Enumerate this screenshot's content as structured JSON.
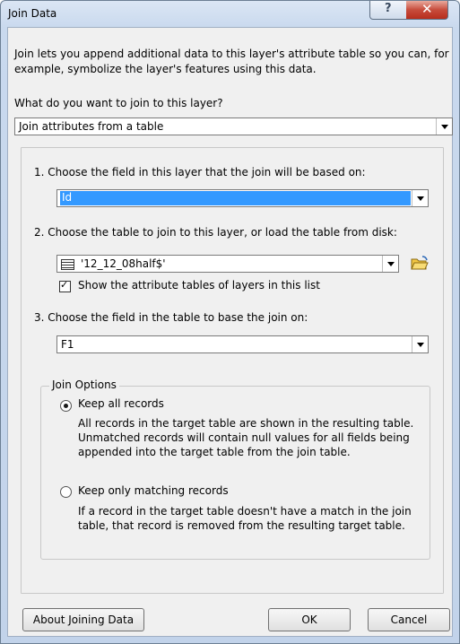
{
  "window": {
    "title": "Join Data",
    "help_glyph": "?",
    "close_glyph": "✕"
  },
  "intro": "Join lets you append additional data to this layer's attribute table so you can, for example, symbolize the layer's features using this data.",
  "question": "What do you want to join to this layer?",
  "join_type": {
    "value": "Join attributes from a table"
  },
  "step1": {
    "label": "1.  Choose the field in this layer that the join will be based on:",
    "value": "Id"
  },
  "step2": {
    "label": "2.  Choose the table to join to this layer, or load the table from disk:",
    "value": "'12_12_08half$'",
    "table_icon": "table-icon",
    "open_icon": "open-folder-icon",
    "show_checkbox": {
      "label": "Show the attribute tables of layers in this list",
      "checked": true
    }
  },
  "step3": {
    "label": "3.  Choose the field in the table to base the join on:",
    "value": "F1"
  },
  "join_options": {
    "legend": "Join Options",
    "keep_all": {
      "label": "Keep all records",
      "selected": true,
      "desc": "All records in the target table are shown in the resulting table. Unmatched records will contain null values for all fields being appended into the target table from the join table."
    },
    "keep_matching": {
      "label": "Keep only matching records",
      "selected": false,
      "desc": "If a record in the target table doesn't have a match in the join table, that record is removed from the resulting target table."
    }
  },
  "buttons": {
    "about": "About Joining Data",
    "ok": "OK",
    "cancel": "Cancel"
  }
}
